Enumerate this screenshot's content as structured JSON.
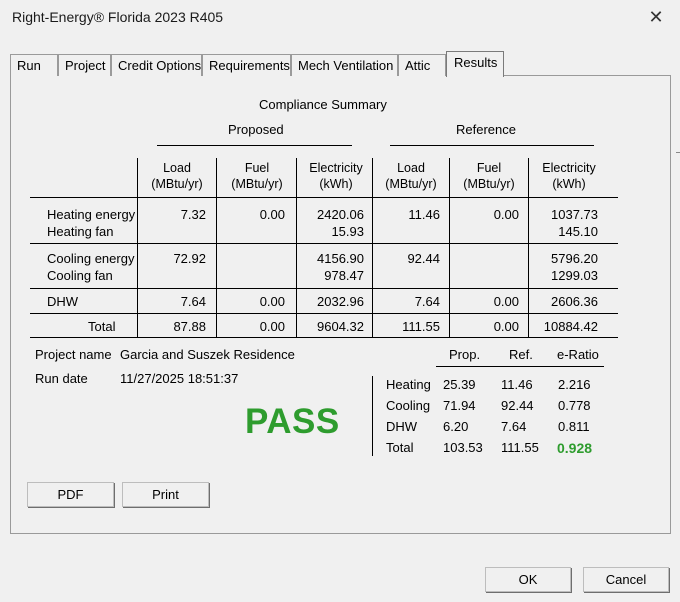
{
  "window": {
    "title": "Right-Energy® Florida 2023 R405",
    "close_glyph": "✕"
  },
  "tabs": [
    {
      "label": "Run"
    },
    {
      "label": "Project"
    },
    {
      "label": "Credit Options"
    },
    {
      "label": "Requirements"
    },
    {
      "label": "Mech Ventilation"
    },
    {
      "label": "Attic"
    },
    {
      "label": "Results",
      "active": true
    }
  ],
  "summary": {
    "title": "Compliance Summary",
    "proposed_label": "Proposed",
    "reference_label": "Reference",
    "columns": {
      "load": [
        "Load",
        "(MBtu/yr)"
      ],
      "fuel": [
        "Fuel",
        "(MBtu/yr)"
      ],
      "electricity": [
        "Electricity",
        "(kWh)"
      ]
    },
    "rows": {
      "heating_energy": {
        "label": "Heating energy",
        "p_load": "7.32",
        "p_fuel": "0.00",
        "p_elec": "2420.06",
        "r_load": "11.46",
        "r_fuel": "0.00",
        "r_elec": "1037.73"
      },
      "heating_fan": {
        "label": "Heating fan",
        "p_elec": "15.93",
        "r_elec": "145.10"
      },
      "cooling_energy": {
        "label": "Cooling energy",
        "p_load": "72.92",
        "p_elec": "4156.90",
        "r_load": "92.44",
        "r_elec": "5796.20"
      },
      "cooling_fan": {
        "label": "Cooling fan",
        "p_elec": "978.47",
        "r_elec": "1299.03"
      },
      "dhw": {
        "label": "DHW",
        "p_load": "7.64",
        "p_fuel": "0.00",
        "p_elec": "2032.96",
        "r_load": "7.64",
        "r_fuel": "0.00",
        "r_elec": "2606.36"
      },
      "total": {
        "label": "Total",
        "p_load": "87.88",
        "p_fuel": "0.00",
        "p_elec": "9604.32",
        "r_load": "111.55",
        "r_fuel": "0.00",
        "r_elec": "10884.42"
      }
    }
  },
  "project": {
    "name_label": "Project name",
    "name_value": "Garcia and Suszek Residence",
    "date_label": "Run date",
    "date_value": "11/27/2025 18:51:37",
    "result": "PASS",
    "result_color": "#2e9c2e"
  },
  "eratio": {
    "headers": {
      "prop": "Prop.",
      "ref": "Ref.",
      "ratio": "e-Ratio"
    },
    "rows": [
      {
        "label": "Heating",
        "prop": "25.39",
        "ref": "11.46",
        "ratio": "2.216"
      },
      {
        "label": "Cooling",
        "prop": "71.94",
        "ref": "92.44",
        "ratio": "0.778"
      },
      {
        "label": "DHW",
        "prop": "6.20",
        "ref": "7.64",
        "ratio": "0.811"
      }
    ],
    "total": {
      "label": "Total",
      "prop": "103.53",
      "ref": "111.55",
      "ratio": "0.928"
    }
  },
  "buttons": {
    "pdf": "PDF",
    "print": "Print",
    "ok": "OK",
    "cancel": "Cancel"
  }
}
